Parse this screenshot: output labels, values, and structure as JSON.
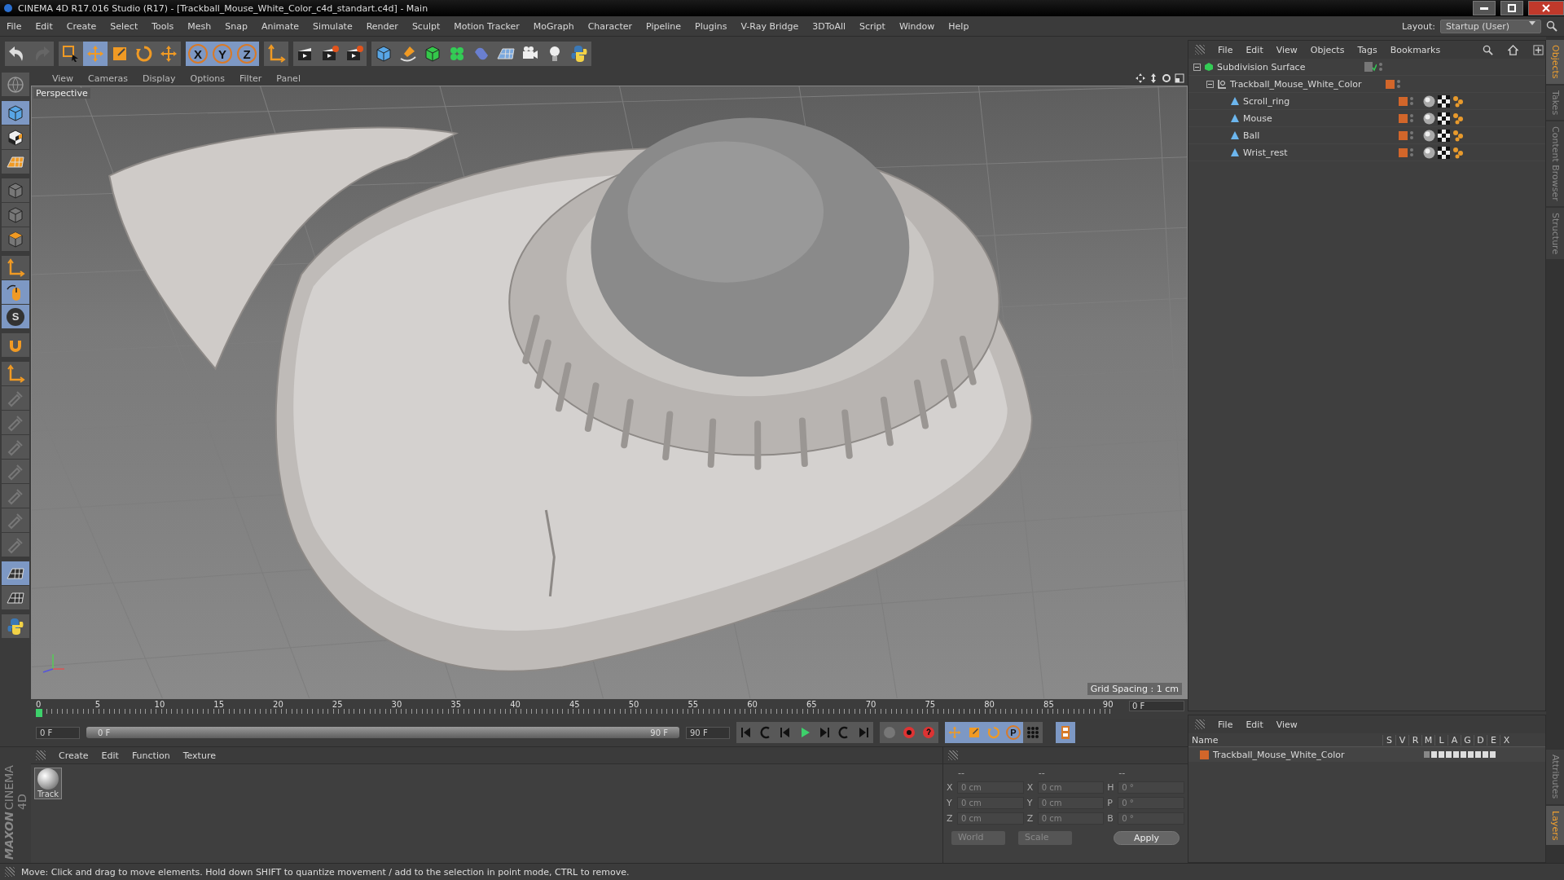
{
  "window": {
    "title": "CINEMA 4D R17.016 Studio (R17) - [Trackball_Mouse_White_Color_c4d_standart.c4d] - Main"
  },
  "menu": [
    "File",
    "Edit",
    "Create",
    "Select",
    "Tools",
    "Mesh",
    "Snap",
    "Animate",
    "Simulate",
    "Render",
    "Sculpt",
    "Motion Tracker",
    "MoGraph",
    "Character",
    "Pipeline",
    "Plugins",
    "V-Ray Bridge",
    "3DToAll",
    "Script",
    "Window",
    "Help"
  ],
  "layout": {
    "label": "Layout:",
    "value": "Startup (User)"
  },
  "toolbar": [
    {
      "selected": false
    },
    {
      "selected": false
    },
    {
      "selected": false
    },
    {
      "selected": true
    },
    {
      "selected": false
    },
    {
      "selected": false
    },
    {
      "selected": false
    },
    {
      "selected": true,
      "label": "X"
    },
    {
      "selected": true,
      "label": "Y"
    },
    {
      "selected": true,
      "label": "Z"
    },
    {
      "selected": false
    },
    {
      "selected": false
    },
    {
      "selected": false
    },
    {
      "selected": false
    },
    {
      "selected": false
    },
    {
      "selected": false
    },
    {
      "selected": false
    },
    {
      "selected": false
    },
    {
      "selected": false
    },
    {
      "selected": false
    },
    {
      "selected": false
    },
    {
      "selected": false
    },
    {
      "selected": false
    }
  ],
  "left_tools": [
    {
      "selected": false
    },
    {
      "selected": true
    },
    {
      "selected": false
    },
    {
      "selected": false
    },
    {
      "selected": false
    },
    {
      "selected": false
    },
    {
      "selected": false
    },
    {
      "selected": false
    },
    {
      "selected": true
    },
    {
      "selected": true,
      "label": "S"
    },
    {
      "selected": false
    },
    {
      "selected": false
    },
    {
      "selected": false
    },
    {
      "selected": false
    },
    {
      "selected": false
    },
    {
      "selected": false
    },
    {
      "selected": false
    },
    {
      "selected": false
    },
    {
      "selected": false
    },
    {
      "selected": true
    },
    {
      "selected": false
    },
    {
      "selected": false
    }
  ],
  "viewport": {
    "menu": [
      "View",
      "Cameras",
      "Display",
      "Options",
      "Filter",
      "Panel"
    ],
    "camera": "Perspective",
    "grid_spacing": "Grid Spacing : 1 cm"
  },
  "timeline": {
    "ticks": [
      "0",
      "5",
      "10",
      "15",
      "20",
      "25",
      "30",
      "35",
      "40",
      "45",
      "50",
      "55",
      "60",
      "65",
      "70",
      "75",
      "80",
      "85",
      "90"
    ],
    "current_frame": "0 F",
    "start": "0 F",
    "range_start": "0 F",
    "range_end": "90 F",
    "range": {
      "level": 1
    },
    "end": "90 F",
    "key_label": "P"
  },
  "materials": {
    "menu": [
      "Create",
      "Edit",
      "Function",
      "Texture"
    ],
    "items": [
      {
        "name": "Track"
      }
    ]
  },
  "logo": {
    "brand": "MAXON",
    "product": "CINEMA 4D"
  },
  "coordinates": {
    "columns": [
      {
        "header": "--",
        "fields": [
          {
            "label": "X",
            "value": "0 cm"
          },
          {
            "label": "Y",
            "value": "0 cm"
          },
          {
            "label": "Z",
            "value": "0 cm"
          }
        ]
      },
      {
        "header": "--",
        "fields": [
          {
            "label": "X",
            "value": "0 cm"
          },
          {
            "label": "Y",
            "value": "0 cm"
          },
          {
            "label": "Z",
            "value": "0 cm"
          }
        ]
      },
      {
        "header": "--",
        "fields": [
          {
            "label": "H",
            "value": "0 °"
          },
          {
            "label": "P",
            "value": "0 °"
          },
          {
            "label": "B",
            "value": "0 °"
          }
        ]
      }
    ],
    "dropdowns": [
      "World",
      "Scale"
    ],
    "apply": "Apply"
  },
  "objects": {
    "menu": [
      "File",
      "Edit",
      "View",
      "Objects",
      "Tags",
      "Bookmarks"
    ],
    "tree": [
      {
        "name": "Subdivision Surface",
        "kind": "generator",
        "expanded": true,
        "children": [
          {
            "name": "Trackball_Mouse_White_Color",
            "kind": "null",
            "expanded": true,
            "children": [
              {
                "name": "Scroll_ring",
                "kind": "polygon"
              },
              {
                "name": "Mouse",
                "kind": "polygon"
              },
              {
                "name": "Ball",
                "kind": "polygon"
              },
              {
                "name": "Wrist_rest",
                "kind": "polygon"
              }
            ]
          }
        ]
      }
    ]
  },
  "layers": {
    "menu": [
      "File",
      "Edit",
      "View"
    ],
    "columns": [
      "Name",
      "S",
      "V",
      "R",
      "M",
      "L",
      "A",
      "G",
      "D",
      "E",
      "X"
    ],
    "rows": [
      {
        "name": "Trackball_Mouse_White_Color"
      }
    ]
  },
  "side_tabs_top": [
    {
      "label": "Objects",
      "selected": true
    },
    {
      "label": "Takes",
      "selected": false
    },
    {
      "label": "Content Browser",
      "selected": false
    },
    {
      "label": "Structure",
      "selected": false
    }
  ],
  "side_tabs_bottom": [
    {
      "label": "Attributes",
      "selected": false
    },
    {
      "label": "Layers",
      "selected": true
    }
  ],
  "status": "Move: Click and drag to move elements. Hold down SHIFT to quantize movement / add to the selection in point mode, CTRL to remove."
}
